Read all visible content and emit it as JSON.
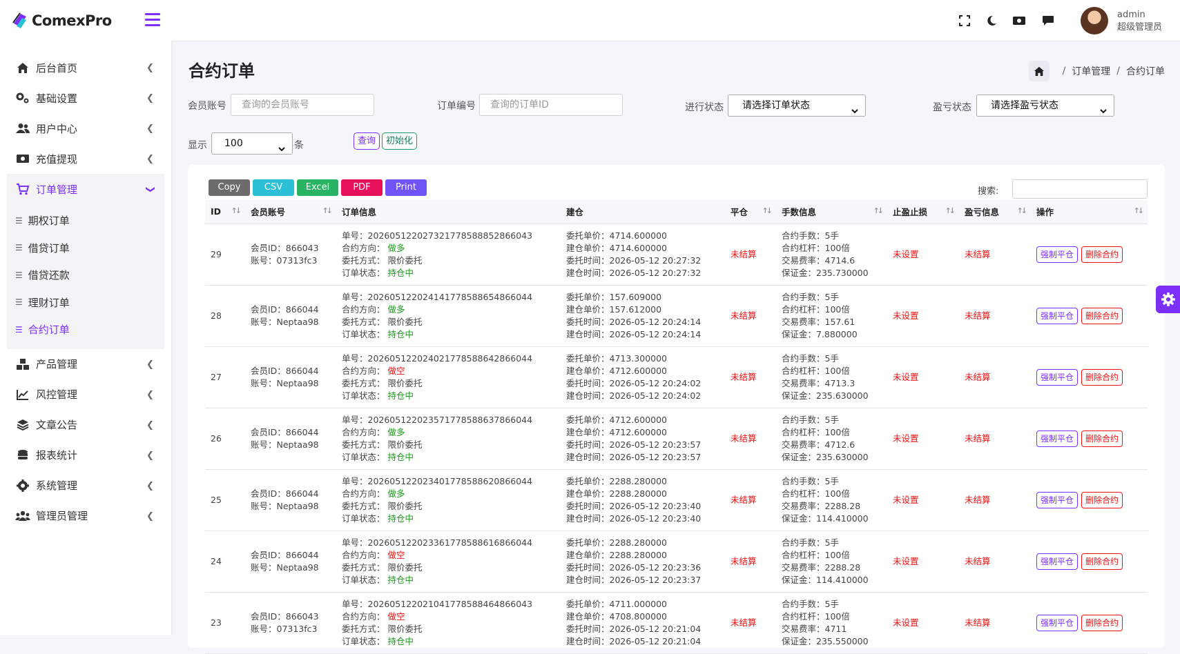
{
  "app": {
    "brand": "ComexPro"
  },
  "sidebar": {
    "items": [
      {
        "label": "后台首页"
      },
      {
        "label": "基础设置"
      },
      {
        "label": "用户中心"
      },
      {
        "label": "充值提现"
      },
      {
        "label": "订单管理"
      },
      {
        "label": "产品管理"
      },
      {
        "label": "风控管理"
      },
      {
        "label": "文章公告"
      },
      {
        "label": "报表统计"
      },
      {
        "label": "系统管理"
      },
      {
        "label": "管理员管理"
      }
    ],
    "sub": [
      {
        "label": "期权订单"
      },
      {
        "label": "借贷订单"
      },
      {
        "label": "借贷还款"
      },
      {
        "label": "理财订单"
      },
      {
        "label": "合约订单"
      }
    ]
  },
  "user": {
    "name": "admin",
    "role": "超级管理员"
  },
  "page": {
    "title": "合约订单",
    "crumb1": "订单管理",
    "crumb2": "合约订单",
    "sep": "/"
  },
  "filters": {
    "member_label": "会员账号",
    "member_placeholder": "查询的会员账号",
    "order_label": "订单编号",
    "order_placeholder": "查询的订单ID",
    "status_label": "进行状态",
    "status_value": "请选择订单状态",
    "pl_label": "盈亏状态",
    "pl_value": "请选择盈亏状态",
    "show_label": "显示",
    "show_value": "100",
    "show_unit": "条",
    "query_btn": "查询",
    "reset_btn": "初始化"
  },
  "export": {
    "copy": "Copy",
    "csv": "CSV",
    "excel": "Excel",
    "pdf": "PDF",
    "print": "Print",
    "search_label": "搜索:"
  },
  "colors": {
    "accent": "#7b2ff7",
    "danger": "#e11",
    "success": "#1a9a1a",
    "copy": "#6c6c6c",
    "csv": "#2bc0d6",
    "excel": "#28b463",
    "pdf": "#e8115b",
    "print": "#7054f5"
  },
  "table": {
    "headers": [
      "ID",
      "会员账号",
      "订单信息",
      "建仓",
      "平仓",
      "手数信息",
      "止盈止损",
      "盈亏信息",
      "操作"
    ],
    "rows": [
      {
        "id": "29",
        "member": "会员ID：866043",
        "account": "账号：07313fc3",
        "order_no": "单号：20260512202732177858885286604​3",
        "direction_label": "合约方向：",
        "direction": "做多",
        "dir_type": "long",
        "method": "委托方式：  限价委托",
        "status_label": "订单状态：",
        "status": "持仓中",
        "entrust_price": "委托单价：4714.600000",
        "open_price": "建仓单价：4714.600000",
        "entrust_time": "委托时间：2026-05-12 20:27:32",
        "open_time": "建仓时间：2026-05-12 20:27:32",
        "close": "未结算",
        "lots": "合约手数：5手",
        "leverage": "合约杠杆：100倍",
        "fee": "交易费率：4714.6",
        "margin": "保证金：235.730000",
        "tpsl": "未设置",
        "pl": "未结算",
        "btn_close": "强制平仓",
        "btn_delete": "删除合约"
      },
      {
        "id": "28",
        "member": "会员ID：866044",
        "account": "账号：Neptaa98",
        "order_no": "单号：20260512202414177858865486604​4",
        "direction_label": "合约方向：",
        "direction": "做多",
        "dir_type": "long",
        "method": "委托方式：  限价委托",
        "status_label": "订单状态：",
        "status": "持仓中",
        "entrust_price": "委托单价：157.609000",
        "open_price": "建仓单价：157.612000",
        "entrust_time": "委托时间：2026-05-12 20:24:14",
        "open_time": "建仓时间：2026-05-12 20:24:14",
        "close": "未结算",
        "lots": "合约手数：5手",
        "leverage": "合约杠杆：100倍",
        "fee": "交易费率：157.61",
        "margin": "保证金：7.880000",
        "tpsl": "未设置",
        "pl": "未结算",
        "btn_close": "强制平仓",
        "btn_delete": "删除合约"
      },
      {
        "id": "27",
        "member": "会员ID：866044",
        "account": "账号：Neptaa98",
        "order_no": "单号：20260512202402177858864286604​4",
        "direction_label": "合约方向：",
        "direction": "做空",
        "dir_type": "short",
        "method": "委托方式：  限价委托",
        "status_label": "订单状态：",
        "status": "持仓中",
        "entrust_price": "委托单价：4713.300000",
        "open_price": "建仓单价：4712.600000",
        "entrust_time": "委托时间：2026-05-12 20:24:02",
        "open_time": "建仓时间：2026-05-12 20:24:02",
        "close": "未结算",
        "lots": "合约手数：5手",
        "leverage": "合约杠杆：100倍",
        "fee": "交易费率：4713.3",
        "margin": "保证金：235.630000",
        "tpsl": "未设置",
        "pl": "未结算",
        "btn_close": "强制平仓",
        "btn_delete": "删除合约"
      },
      {
        "id": "26",
        "member": "会员ID：866044",
        "account": "账号：Neptaa98",
        "order_no": "单号：20260512202357177858863786604​4",
        "direction_label": "合约方向：",
        "direction": "做多",
        "dir_type": "long",
        "method": "委托方式：  限价委托",
        "status_label": "订单状态：",
        "status": "持仓中",
        "entrust_price": "委托单价：4712.600000",
        "open_price": "建仓单价：4712.600000",
        "entrust_time": "委托时间：2026-05-12 20:23:57",
        "open_time": "建仓时间：2026-05-12 20:23:57",
        "close": "未结算",
        "lots": "合约手数：5手",
        "leverage": "合约杠杆：100倍",
        "fee": "交易费率：4712.6",
        "margin": "保证金：235.630000",
        "tpsl": "未设置",
        "pl": "未结算",
        "btn_close": "强制平仓",
        "btn_delete": "删除合约"
      },
      {
        "id": "25",
        "member": "会员ID：866044",
        "account": "账号：Neptaa98",
        "order_no": "单号：20260512202340177858862086604​4",
        "direction_label": "合约方向：",
        "direction": "做多",
        "dir_type": "long",
        "method": "委托方式：  限价委托",
        "status_label": "订单状态：",
        "status": "持仓中",
        "entrust_price": "委托单价：2288.280000",
        "open_price": "建仓单价：2288.280000",
        "entrust_time": "委托时间：2026-05-12 20:23:40",
        "open_time": "建仓时间：2026-05-12 20:23:40",
        "close": "未结算",
        "lots": "合约手数：5手",
        "leverage": "合约杠杆：100倍",
        "fee": "交易费率：2288.28",
        "margin": "保证金：114.410000",
        "tpsl": "未设置",
        "pl": "未结算",
        "btn_close": "强制平仓",
        "btn_delete": "删除合约"
      },
      {
        "id": "24",
        "member": "会员ID：866044",
        "account": "账号：Neptaa98",
        "order_no": "单号：20260512202336177858861686604​4",
        "direction_label": "合约方向：",
        "direction": "做空",
        "dir_type": "short",
        "method": "委托方式：  限价委托",
        "status_label": "订单状态：",
        "status": "持仓中",
        "entrust_price": "委托单价：2288.280000",
        "open_price": "建仓单价：2288.280000",
        "entrust_time": "委托时间：2026-05-12 20:23:36",
        "open_time": "建仓时间：2026-05-12 20:23:37",
        "close": "未结算",
        "lots": "合约手数：5手",
        "leverage": "合约杠杆：100倍",
        "fee": "交易费率：2288.28",
        "margin": "保证金：114.410000",
        "tpsl": "未设置",
        "pl": "未结算",
        "btn_close": "强制平仓",
        "btn_delete": "删除合约"
      },
      {
        "id": "23",
        "member": "会员ID：866043",
        "account": "账号：07313fc3",
        "order_no": "单号：20260512202104177858846486604​3",
        "direction_label": "合约方向：",
        "direction": "做空",
        "dir_type": "short",
        "method": "委托方式：  限价委托",
        "status_label": "订单状态：",
        "status": "持仓中",
        "entrust_price": "委托单价：4711.000000",
        "open_price": "建仓单价：4708.800000",
        "entrust_time": "委托时间：2026-05-12 20:21:04",
        "open_time": "建仓时间：2026-05-12 20:21:04",
        "close": "未结算",
        "lots": "合约手数：5手",
        "leverage": "合约杠杆：100倍",
        "fee": "交易费率：4711",
        "margin": "保证金：235.550000",
        "tpsl": "未设置",
        "pl": "未结算",
        "btn_close": "强制平仓",
        "btn_delete": "删除合约"
      }
    ]
  }
}
